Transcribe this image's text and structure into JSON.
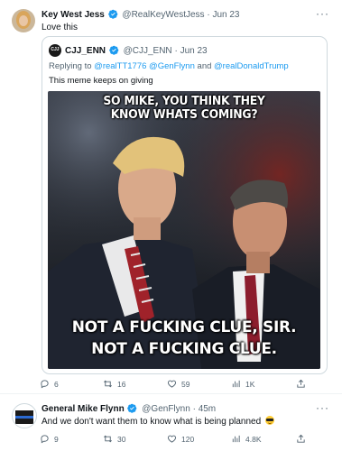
{
  "tweets": [
    {
      "author_name": "Key West Jess",
      "author_handle": "@RealKeyWestJess",
      "dot": "·",
      "date": "Jun 23",
      "text": "Love this",
      "more": "···",
      "quote": {
        "author_name": "CJJ_ENN",
        "author_handle": "@CJJ_ENN",
        "dot": "·",
        "date": "Jun 23",
        "replying_label": "Replying to",
        "reply_mention_1": "@realTT1776",
        "reply_mention_2": "@GenFlynn",
        "reply_and": "and",
        "reply_mention_3": "@realDonaldTrump",
        "text": "This meme keeps on giving",
        "avatar_text": "CJJ",
        "meme": {
          "top_line_1": "SO MIKE, YOU THINK THEY",
          "top_line_2": "KNOW WHATS COMING?",
          "bottom_line_1": "NOT A FUCKING CLUE, SIR.",
          "bottom_line_2": "NOT A FUCKING CLUE."
        }
      },
      "actions": {
        "replies": "6",
        "retweets": "16",
        "likes": "59",
        "views": "1K"
      }
    },
    {
      "author_name": "General Mike Flynn",
      "author_handle": "@GenFlynn",
      "dot": "·",
      "date": "45m",
      "text": "And we don't want them to know what is being planned",
      "emoji_name": "smiling-face-with-sunglasses",
      "more": "···",
      "actions": {
        "replies": "9",
        "retweets": "30",
        "likes": "120",
        "views": "4.8K"
      }
    }
  ],
  "colors": {
    "accent": "#1d9bf0",
    "verified": "#1d9bf0",
    "muted_text": "#536471",
    "border": "#cfd9de"
  }
}
